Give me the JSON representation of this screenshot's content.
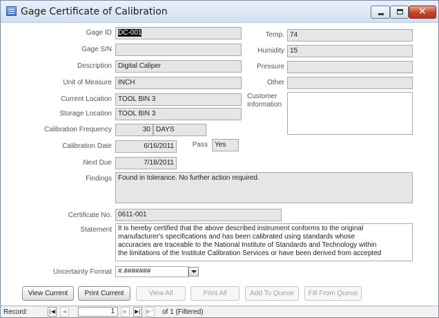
{
  "window": {
    "title": "Gage Certificate of Calibration"
  },
  "labels": {
    "gage_id": "Gage ID",
    "gage_sn": "Gage S/N",
    "description": "Description",
    "unit": "Unit of Measure",
    "current_location": "Current Location",
    "storage_location": "Storage Location",
    "cal_frequency": "Calibration Frequency",
    "cal_date": "Calibration Date",
    "pass": "Pass",
    "next_due": "Next Due",
    "findings": "Findings",
    "cert_no": "Certificate No.",
    "statement": "Statement",
    "uncertainty": "Uncertainty Format",
    "temp": "Temp.",
    "humidity": "Humidity",
    "pressure": "Pressure",
    "other": "Other",
    "customer_info_1": "Customer",
    "customer_info_2": "Information"
  },
  "values": {
    "gage_id": "DC-001",
    "gage_sn": "",
    "description": "Digital Caliper",
    "unit": "INCH",
    "current_location": "TOOL BIN 3",
    "storage_location": "TOOL BIN 3",
    "cal_frequency": "30",
    "cal_frequency_unit": "DAYS",
    "cal_date": "6/16/2011",
    "pass": "Yes",
    "next_due": "7/18/2011",
    "findings": "Found in tolerance. No further action required.",
    "cert_no": "0611-001",
    "statement_lines": [
      "It is hereby certified that the above described instrument conforms to the original",
      "manufacturer's specifications and has been calibrated using standards whose",
      "accuracies are traceable to the National Institute of Standards and Technology within",
      "the limitations of the Institute Calibration Services or have been derived from accepted"
    ],
    "uncertainty": "#.#######",
    "temp": "74",
    "humidity": "15",
    "pressure": "",
    "other": "",
    "customer_info": ""
  },
  "buttons": {
    "view_current": "View Current",
    "print_current": "Print Current",
    "view_all": "View All",
    "print_all": "Print All",
    "add_to_queue": "Add To Queue",
    "fill_from_queue": "Fill From Queue"
  },
  "navigation": {
    "record_label": "Record:",
    "current_record": "1",
    "of_text": "of 1 (Filtered)"
  },
  "icons": {
    "first": "first-record-icon",
    "prev": "previous-record-icon",
    "next": "next-record-icon",
    "last": "last-record-icon",
    "new": "new-record-icon"
  },
  "colors": {
    "field_bg": "#e6e6e6",
    "title_gradient_top": "#e9f0f9",
    "close_button": "#c4432a"
  }
}
